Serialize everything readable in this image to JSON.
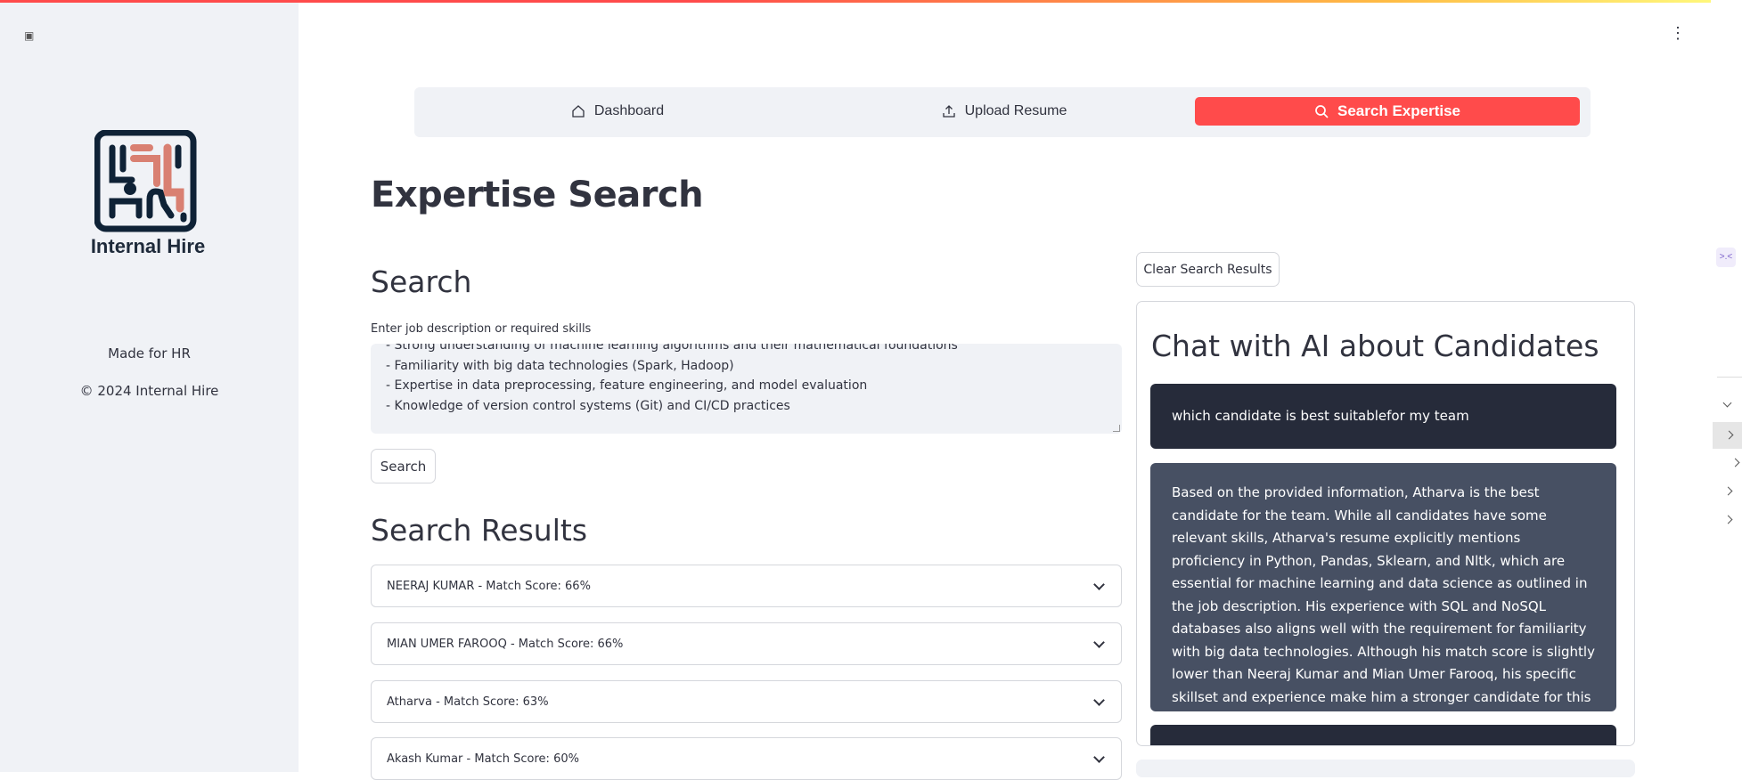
{
  "sidebar": {
    "toggle_glyph": "▣",
    "logo_text": "Internal Hire",
    "made_for": "Made for HR",
    "copyright": "© 2024 Internal Hire"
  },
  "nav": {
    "items": [
      {
        "label": "Dashboard",
        "icon": "home-icon",
        "active": false
      },
      {
        "label": "Upload Resume",
        "icon": "upload-icon",
        "active": true
      },
      {
        "label": "Search Expertise",
        "icon": "search-icon",
        "active": true
      }
    ]
  },
  "page": {
    "title": "Expertise Search",
    "search_heading": "Search",
    "input_label": "Enter job description or required skills",
    "input_lines": [
      "- Strong understanding of machine learning algorithms and their mathematical foundations",
      "- Familiarity with big data technologies (Spark, Hadoop)",
      "- Expertise in data preprocessing, feature engineering, and model evaluation",
      "- Knowledge of version control systems (Git) and CI/CD practices"
    ],
    "search_button": "Search",
    "results_heading": "Search Results",
    "results": [
      "NEERAJ KUMAR - Match Score: 66%",
      "MIAN UMER FAROOQ - Match Score: 66%",
      "Atharva - Match Score: 63%",
      "Akash Kumar - Match Score: 60%"
    ]
  },
  "chat": {
    "clear_button": "Clear Search Results",
    "title": "Chat with AI about Candidates",
    "user_message": "which candidate is best suitablefor my team",
    "ai_message": "Based on the provided information, Atharva is the best candidate for the team. While all candidates have some relevant skills, Atharva's resume explicitly mentions proficiency in Python, Pandas, Sklearn, and Nltk, which are essential for machine learning and data science as outlined in the job description. His experience with SQL and NoSQL databases also aligns well with the requirement for familiarity with big data technologies. Although his match score is slightly lower than Neeraj Kumar and Mian Umer Farooq, his specific skillset and experience make him a stronger candidate for this role."
  },
  "colors": {
    "accent": "#ff4b4b",
    "sidebar_bg": "#f0f2f6",
    "user_bubble": "#262b3a",
    "ai_bubble": "#475063",
    "logo_dark": "#0f2236",
    "logo_accent": "#d98072"
  },
  "menu_glyph": "⋮"
}
